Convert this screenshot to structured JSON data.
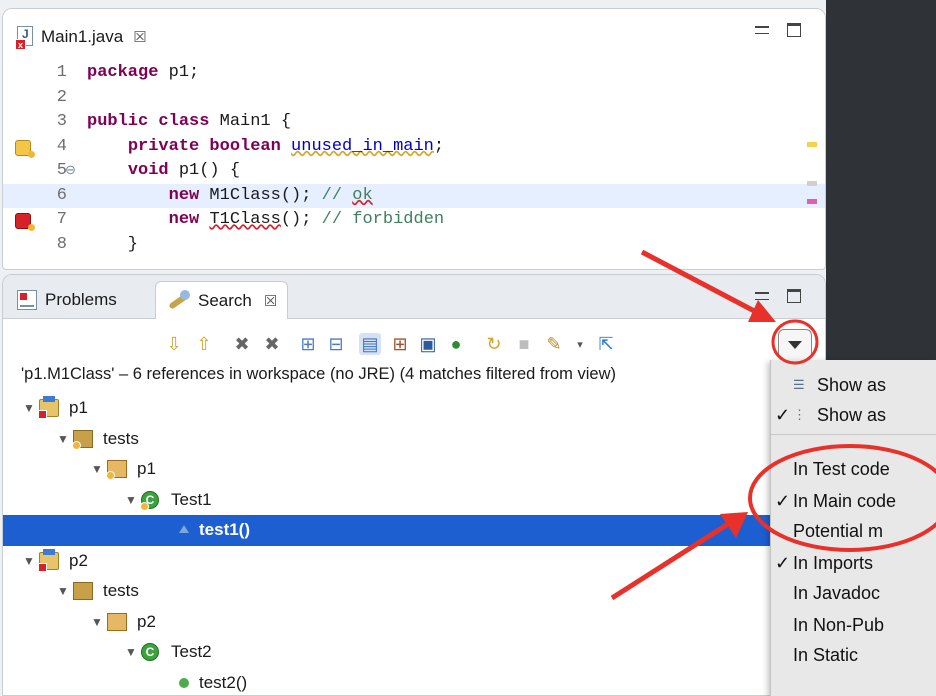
{
  "editor": {
    "tab_label": "Main1.java",
    "tab_close": "☒",
    "lines": [
      {
        "n": "1",
        "parts": [
          [
            "kw",
            "package"
          ],
          [
            "t",
            " p1;"
          ]
        ]
      },
      {
        "n": "2",
        "parts": []
      },
      {
        "n": "3",
        "parts": [
          [
            "kw",
            "public class"
          ],
          [
            "t",
            " Main1 {"
          ]
        ]
      },
      {
        "n": "4",
        "parts": [
          [
            "t",
            "    "
          ],
          [
            "kw",
            "private boolean"
          ],
          [
            "t",
            " "
          ],
          [
            "fld",
            "unused_in_main"
          ],
          [
            "t",
            ";"
          ]
        ],
        "mark": "warn"
      },
      {
        "n": "5",
        "parts": [
          [
            "t",
            "    "
          ],
          [
            "kw",
            "void"
          ],
          [
            "t",
            " p1() {"
          ]
        ],
        "fold": "⊖"
      },
      {
        "n": "6",
        "parts": [
          [
            "t",
            "        "
          ],
          [
            "kw",
            "new"
          ],
          [
            "t",
            " M1Class(); "
          ],
          [
            "cm",
            "// "
          ],
          [
            "cmsq",
            "ok"
          ]
        ],
        "hl": true
      },
      {
        "n": "7",
        "parts": [
          [
            "t",
            "        "
          ],
          [
            "kw",
            "new"
          ],
          [
            "t",
            " "
          ],
          [
            "sq",
            "T1Class"
          ],
          [
            "t",
            "(); "
          ],
          [
            "cm",
            "// forbidden"
          ]
        ],
        "mark": "err"
      },
      {
        "n": "8",
        "parts": [
          [
            "t",
            "    }"
          ]
        ]
      }
    ]
  },
  "search_panel": {
    "tabs": [
      {
        "label": "Problems"
      },
      {
        "label": "Search",
        "close": "☒"
      }
    ],
    "summary": "'p1.M1Class' – 6 references in workspace (no JRE) (4 matches filtered from view)",
    "tree": [
      {
        "label": "p1",
        "level": 0,
        "icon": "project",
        "badge": "err"
      },
      {
        "label": "tests",
        "level": 1,
        "icon": "source-folder",
        "badge": "warn"
      },
      {
        "label": "p1",
        "level": 2,
        "icon": "package",
        "badge": "warn"
      },
      {
        "label": "Test1",
        "level": 3,
        "icon": "class",
        "badge": "warn"
      },
      {
        "label": "test1()",
        "level": 4,
        "icon": "method-alt",
        "selected": true
      },
      {
        "label": "p2",
        "level": 0,
        "icon": "project",
        "badge": "err"
      },
      {
        "label": "tests",
        "level": 1,
        "icon": "source-folder"
      },
      {
        "label": "p2",
        "level": 2,
        "icon": "package"
      },
      {
        "label": "Test2",
        "level": 3,
        "icon": "class"
      },
      {
        "label": "test2()",
        "level": 4,
        "icon": "method"
      }
    ]
  },
  "dropdown_menu": {
    "items": [
      {
        "label": "Show as",
        "icon": "list",
        "checked": false
      },
      {
        "label": "Show as",
        "icon": "tree",
        "checked": true
      },
      {
        "label": "In Test code",
        "checked": false
      },
      {
        "label": "In Main code",
        "checked": true
      },
      {
        "label": "Potential m",
        "checked": false
      },
      {
        "label": "In Imports",
        "checked": true
      },
      {
        "label": "In Javadoc",
        "checked": false
      },
      {
        "label": "In Non-Pub",
        "checked": false
      },
      {
        "label": "In Static",
        "checked": false
      }
    ]
  },
  "colors": {
    "selection": "#1d5fd1",
    "annotation_red": "#e8312a",
    "keyword": "#7f0055",
    "comment": "#3f7f5f"
  }
}
